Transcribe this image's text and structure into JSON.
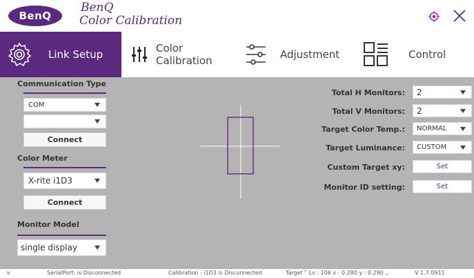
{
  "brand": {
    "logo_text": "BenQ",
    "title_line1": "BenQ",
    "title_line2": "Color Calibration"
  },
  "tabs": [
    {
      "label": "Link Setup",
      "active": true
    },
    {
      "label": "Color Calibration",
      "active": false
    },
    {
      "label": "Adjustment",
      "active": false
    },
    {
      "label": "Control",
      "active": false
    }
  ],
  "left": {
    "communication_type": {
      "title": "Communication Type",
      "port_value": "COM",
      "second_value": "",
      "connect_label": "Connect"
    },
    "color_meter": {
      "title": "Color Meter",
      "value": "X-rite i1D3",
      "connect_label": "Connect"
    },
    "monitor_model": {
      "title": "Monitor Model",
      "value": "single display"
    }
  },
  "right": {
    "total_h": {
      "label": "Total H Monitors:",
      "value": "2"
    },
    "total_v": {
      "label": "Total V Monitors:",
      "value": "2"
    },
    "target_color_temp": {
      "label": "Target Color Temp.:",
      "value": "NORMAL"
    },
    "target_luminance": {
      "label": "Target Luminance:",
      "value": "CUSTOM"
    },
    "custom_target_xy": {
      "label": "Custom Target xy:",
      "button": "Set"
    },
    "monitor_id": {
      "label": "Monitor ID setting:",
      "button": "Set"
    }
  },
  "status": {
    "corner_glyph": "v",
    "serial_port": "SerialPort:  is Disconnected",
    "calibration": "Calibration : i1D3 is Disconnected",
    "target": "Target  ⌜ Lv : 106 x  : 0.280 y : 0.290 ⌟",
    "version": "V 1.7.0911"
  },
  "colors": {
    "accent": "#5b2a80",
    "panel_bg": "#b4b4b4"
  }
}
